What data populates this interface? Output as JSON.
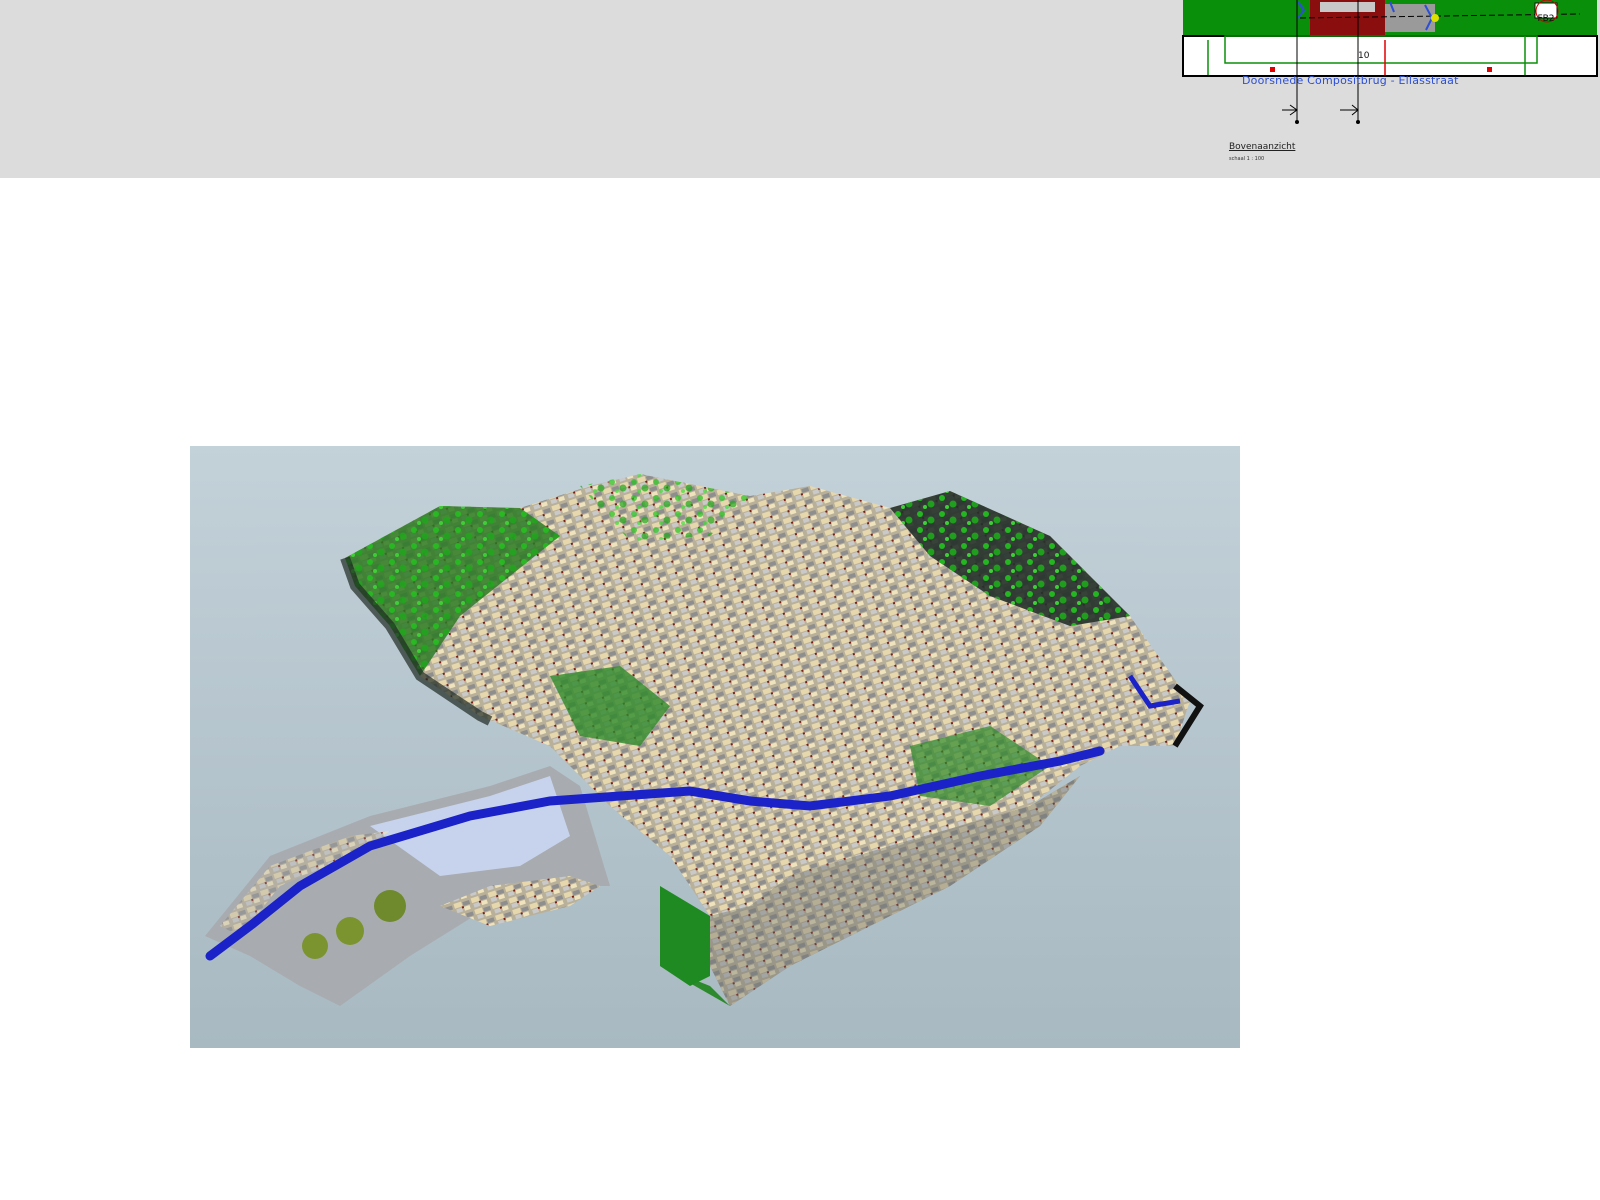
{
  "drawing": {
    "section_title": "Doorsnede Compositbrug - Ellasstraat",
    "plan_label": "Bovenaanzicht",
    "plan_scale": "schaal 1 : 100",
    "tag": "FB2",
    "dimension": "10"
  },
  "colors": {
    "band": "#dcdcdc",
    "drawing_green": "#0a8f0a",
    "drawing_blue": "#2b4fd8",
    "water": "#1a22c8",
    "sky": "#b8c8d0"
  }
}
